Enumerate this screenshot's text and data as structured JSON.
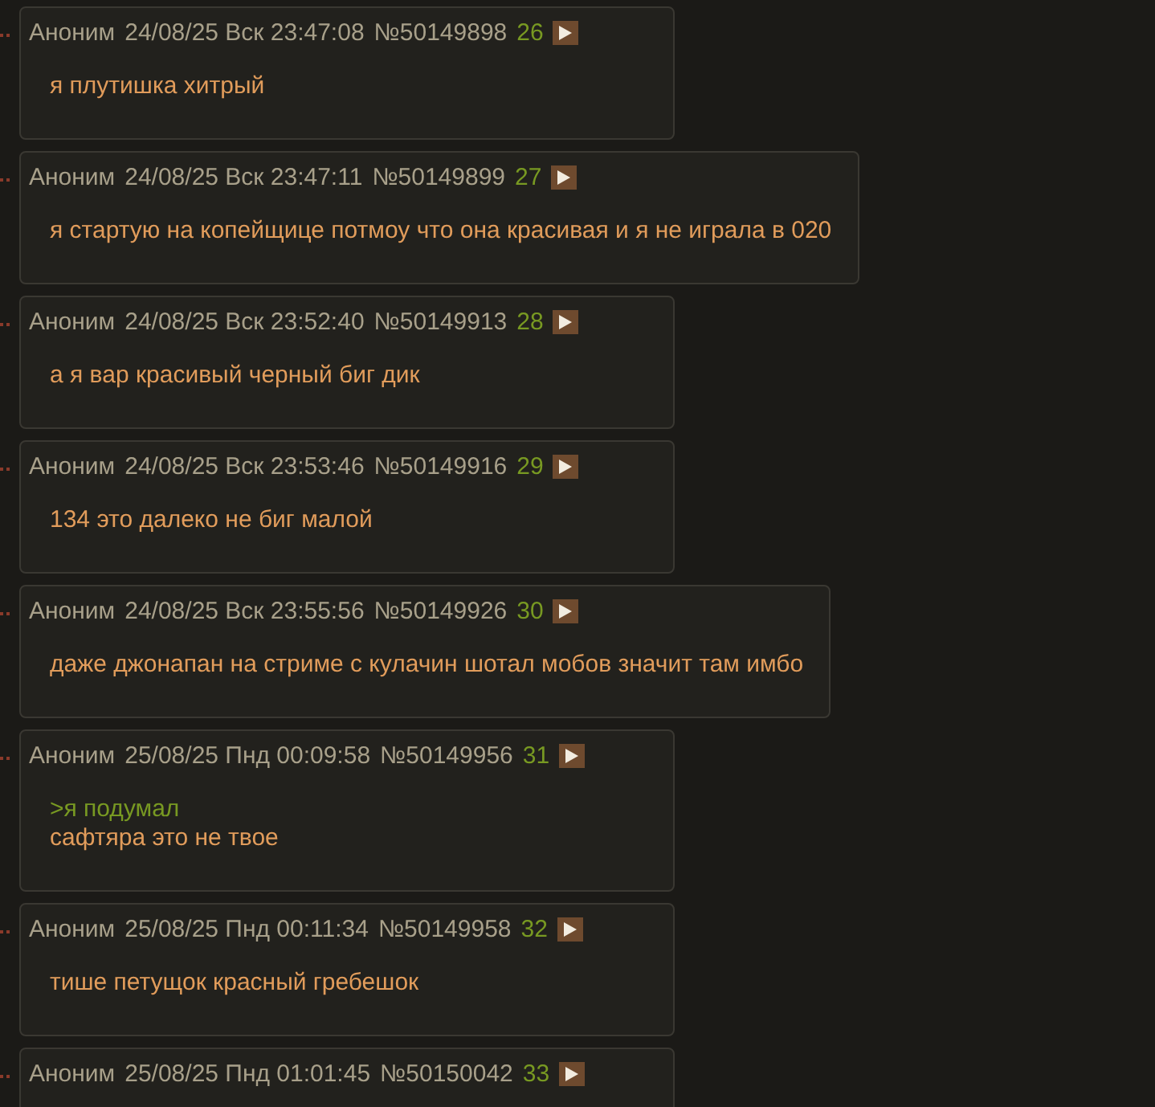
{
  "posts": [
    {
      "author": "Аноним",
      "date": "24/08/25 Вск 23:47:08",
      "number": "№50149898",
      "index": "26",
      "lines": [
        {
          "kind": "text",
          "text": "я плутишка хитрый"
        }
      ]
    },
    {
      "author": "Аноним",
      "date": "24/08/25 Вск 23:47:11",
      "number": "№50149899",
      "index": "27",
      "lines": [
        {
          "kind": "text",
          "text": "я стартую на копейщице потмоу что она красивая и я не играла в 020"
        }
      ]
    },
    {
      "author": "Аноним",
      "date": "24/08/25 Вск 23:52:40",
      "number": "№50149913",
      "index": "28",
      "lines": [
        {
          "kind": "text",
          "text": "а я вар красивый черный биг дик"
        }
      ]
    },
    {
      "author": "Аноним",
      "date": "24/08/25 Вск 23:53:46",
      "number": "№50149916",
      "index": "29",
      "lines": [
        {
          "kind": "text",
          "text": "134 это далеко не биг малой"
        }
      ]
    },
    {
      "author": "Аноним",
      "date": "24/08/25 Вск 23:55:56",
      "number": "№50149926",
      "index": "30",
      "lines": [
        {
          "kind": "text",
          "text": "даже джонапан на стриме с кулачин шотал мобов значит там имбо"
        }
      ]
    },
    {
      "author": "Аноним",
      "date": "25/08/25 Пнд 00:09:58",
      "number": "№50149956",
      "index": "31",
      "lines": [
        {
          "kind": "quote",
          "text": ">я подумал"
        },
        {
          "kind": "text",
          "text": "сафтяра это не твое"
        }
      ]
    },
    {
      "author": "Аноним",
      "date": "25/08/25 Пнд 00:11:34",
      "number": "№50149958",
      "index": "32",
      "lines": [
        {
          "kind": "text",
          "text": "тише петущок красный гребешок"
        }
      ]
    },
    {
      "author": "Аноним",
      "date": "25/08/25 Пнд 01:01:45",
      "number": "№50150042",
      "index": "33"
    }
  ]
}
